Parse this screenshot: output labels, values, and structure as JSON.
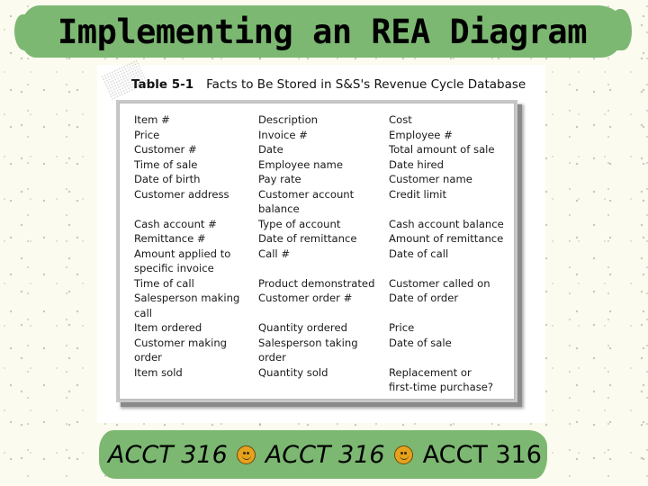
{
  "slide": {
    "title": "Implementing an REA Diagram",
    "table": {
      "label": "Table 5-1",
      "caption": "Facts to Be Stored in S&S's Revenue Cycle Database",
      "rows": [
        [
          "Item #",
          "Description",
          "Cost"
        ],
        [
          "Price",
          "Invoice #",
          "Employee #"
        ],
        [
          "Customer #",
          "Date",
          "Total amount of sale"
        ],
        [
          "Time of sale",
          "Employee name",
          "Date hired"
        ],
        [
          "Date of birth",
          "Pay rate",
          "Customer name"
        ],
        [
          "Customer address",
          "Customer account\nbalance",
          "Credit limit"
        ],
        [
          "Cash account #",
          "Type of account",
          "Cash account balance"
        ],
        [
          "Remittance #",
          "Date of remittance",
          "Amount of remittance"
        ],
        [
          "Amount applied to\nspecific invoice",
          "Call #",
          "Date of call"
        ],
        [
          "Time of call",
          "Product demonstrated",
          "Customer called on"
        ],
        [
          "Salesperson making\ncall",
          "Customer order #",
          "Date of order"
        ],
        [
          "Item ordered",
          "Quantity ordered",
          "Price"
        ],
        [
          "Customer making\norder",
          "Salesperson taking\norder",
          "Date of sale"
        ],
        [
          "Item sold",
          "Quantity sold",
          "Replacement or\nfirst-time purchase?"
        ]
      ]
    },
    "footer": {
      "items": [
        "ACCT 316",
        "ACCT 316",
        "ACCT 316"
      ],
      "separator_icon": "smiley-face-icon"
    },
    "colors": {
      "band_green": "#7cb872",
      "background": "#fbfbef",
      "smiley": "#e6a21c"
    }
  }
}
